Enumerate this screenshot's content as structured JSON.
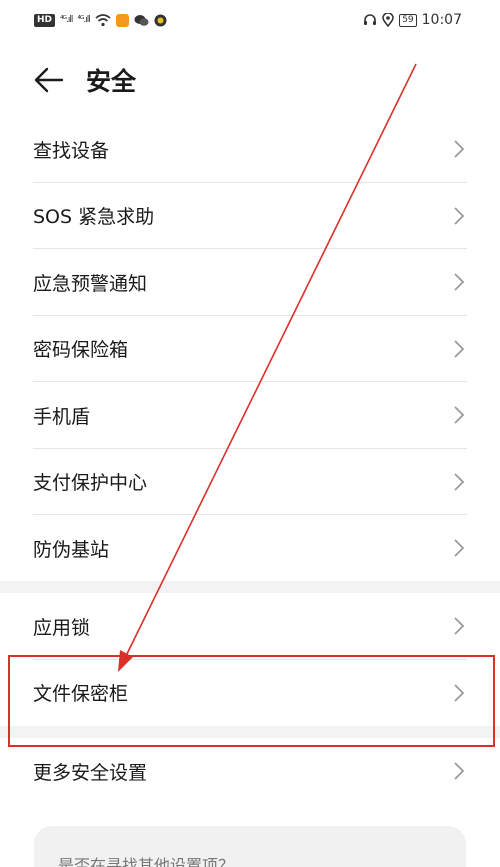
{
  "status_bar": {
    "hd": "HD",
    "signal1": "⁴ᴳ.ıll",
    "signal2": "⁴ᴳ.ıll",
    "battery": "59",
    "time": "10:07"
  },
  "header": {
    "title": "安全"
  },
  "group1": [
    {
      "label": "查找设备"
    },
    {
      "label": "SOS 紧急求助"
    },
    {
      "label": "应急预警通知"
    },
    {
      "label": "密码保险箱"
    },
    {
      "label": "手机盾"
    },
    {
      "label": "支付保护中心"
    },
    {
      "label": "防伪基站"
    }
  ],
  "group2": [
    {
      "label": "应用锁"
    },
    {
      "label": "文件保密柜"
    }
  ],
  "group3": [
    {
      "label": "更多安全设置"
    }
  ],
  "search_card": {
    "text": "是否在寻找其他设置项？"
  },
  "colors": {
    "annotation": "#d9302a",
    "divider": "#e6e6e6",
    "section_gap": "#f3f3f3"
  }
}
